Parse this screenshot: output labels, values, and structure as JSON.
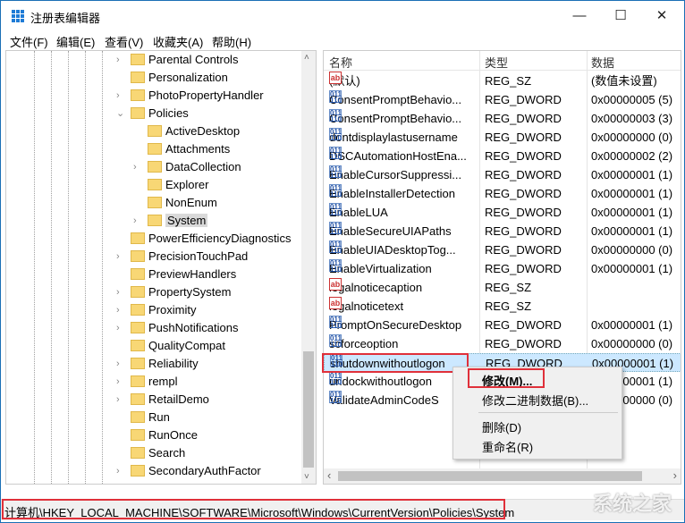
{
  "window": {
    "title": "注册表编辑器",
    "minimize": "—",
    "maximize": "☐",
    "close": "✕"
  },
  "menu": [
    "文件(F)",
    "编辑(E)",
    "查看(V)",
    "收藏夹(A)",
    "帮助(H)"
  ],
  "tree": [
    {
      "label": "Parental Controls",
      "level": 0,
      "arrow": "›"
    },
    {
      "label": "Personalization",
      "level": 0,
      "arrow": ""
    },
    {
      "label": "PhotoPropertyHandler",
      "level": 0,
      "arrow": "›"
    },
    {
      "label": "Policies",
      "level": 0,
      "arrow": "⌄"
    },
    {
      "label": "ActiveDesktop",
      "level": 1,
      "arrow": ""
    },
    {
      "label": "Attachments",
      "level": 1,
      "arrow": ""
    },
    {
      "label": "DataCollection",
      "level": 1,
      "arrow": "›"
    },
    {
      "label": "Explorer",
      "level": 1,
      "arrow": ""
    },
    {
      "label": "NonEnum",
      "level": 1,
      "arrow": ""
    },
    {
      "label": "System",
      "level": 1,
      "arrow": "›",
      "selected": true
    },
    {
      "label": "PowerEfficiencyDiagnostics",
      "level": 0,
      "arrow": ""
    },
    {
      "label": "PrecisionTouchPad",
      "level": 0,
      "arrow": "›"
    },
    {
      "label": "PreviewHandlers",
      "level": 0,
      "arrow": ""
    },
    {
      "label": "PropertySystem",
      "level": 0,
      "arrow": "›"
    },
    {
      "label": "Proximity",
      "level": 0,
      "arrow": "›"
    },
    {
      "label": "PushNotifications",
      "level": 0,
      "arrow": "›"
    },
    {
      "label": "QualityCompat",
      "level": 0,
      "arrow": ""
    },
    {
      "label": "Reliability",
      "level": 0,
      "arrow": "›"
    },
    {
      "label": "rempl",
      "level": 0,
      "arrow": "›"
    },
    {
      "label": "RetailDemo",
      "level": 0,
      "arrow": "›"
    },
    {
      "label": "Run",
      "level": 0,
      "arrow": ""
    },
    {
      "label": "RunOnce",
      "level": 0,
      "arrow": ""
    },
    {
      "label": "Search",
      "level": 0,
      "arrow": ""
    },
    {
      "label": "SecondaryAuthFactor",
      "level": 0,
      "arrow": "›"
    }
  ],
  "columns": {
    "name": "名称",
    "type": "类型",
    "data": "数据"
  },
  "values": [
    {
      "name": "(默认)",
      "type": "REG_SZ",
      "data": "(数值未设置)",
      "icon": "string"
    },
    {
      "name": "ConsentPromptBehavio...",
      "type": "REG_DWORD",
      "data": "0x00000005 (5)",
      "icon": "dword"
    },
    {
      "name": "ConsentPromptBehavio...",
      "type": "REG_DWORD",
      "data": "0x00000003 (3)",
      "icon": "dword"
    },
    {
      "name": "dontdisplaylastusername",
      "type": "REG_DWORD",
      "data": "0x00000000 (0)",
      "icon": "dword"
    },
    {
      "name": "DSCAutomationHostEna...",
      "type": "REG_DWORD",
      "data": "0x00000002 (2)",
      "icon": "dword"
    },
    {
      "name": "EnableCursorSuppressi...",
      "type": "REG_DWORD",
      "data": "0x00000001 (1)",
      "icon": "dword"
    },
    {
      "name": "EnableInstallerDetection",
      "type": "REG_DWORD",
      "data": "0x00000001 (1)",
      "icon": "dword"
    },
    {
      "name": "EnableLUA",
      "type": "REG_DWORD",
      "data": "0x00000001 (1)",
      "icon": "dword"
    },
    {
      "name": "EnableSecureUIAPaths",
      "type": "REG_DWORD",
      "data": "0x00000001 (1)",
      "icon": "dword"
    },
    {
      "name": "EnableUIADesktopTog...",
      "type": "REG_DWORD",
      "data": "0x00000000 (0)",
      "icon": "dword"
    },
    {
      "name": "EnableVirtualization",
      "type": "REG_DWORD",
      "data": "0x00000001 (1)",
      "icon": "dword"
    },
    {
      "name": "legalnoticecaption",
      "type": "REG_SZ",
      "data": "",
      "icon": "string"
    },
    {
      "name": "legalnoticetext",
      "type": "REG_SZ",
      "data": "",
      "icon": "string"
    },
    {
      "name": "PromptOnSecureDesktop",
      "type": "REG_DWORD",
      "data": "0x00000001 (1)",
      "icon": "dword"
    },
    {
      "name": "scforceoption",
      "type": "REG_DWORD",
      "data": "0x00000000 (0)",
      "icon": "dword"
    },
    {
      "name": "shutdownwithoutlogon",
      "type": "REG_DWORD",
      "data": "0x00000001 (1)",
      "icon": "dword",
      "selected": true
    },
    {
      "name": "undockwithoutlogon",
      "type": "REG_DWORD",
      "data": "0x00000001 (1)",
      "icon": "dword"
    },
    {
      "name": "ValidateAdminCodeS",
      "type": "REG_DWORD",
      "data": "0x00000000 (0)",
      "icon": "dword"
    }
  ],
  "context_menu": {
    "modify": "修改(M)...",
    "modify_binary": "修改二进制数据(B)...",
    "delete": "删除(D)",
    "rename": "重命名(R)"
  },
  "status": "计算机\\HKEY_LOCAL_MACHINE\\SOFTWARE\\Microsoft\\Windows\\CurrentVersion\\Policies\\System",
  "watermark": "系统之家"
}
